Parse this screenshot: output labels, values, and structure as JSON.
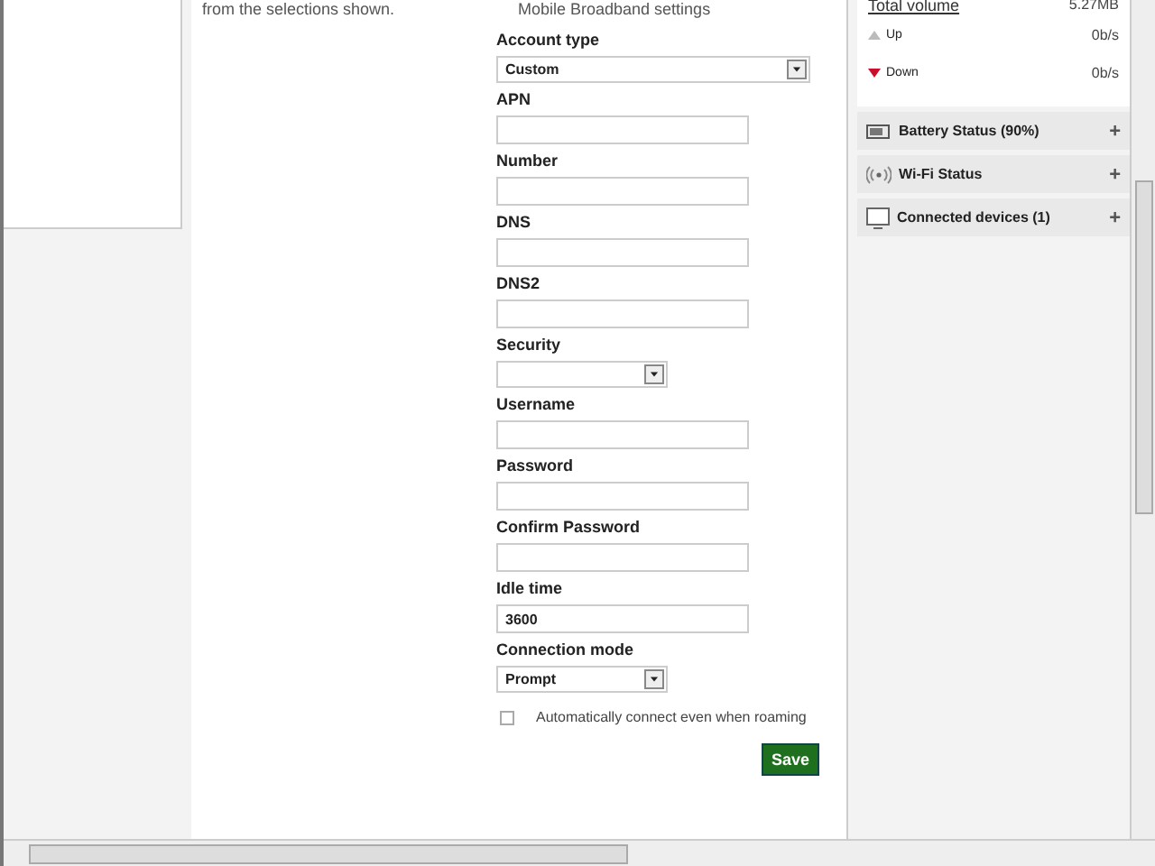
{
  "sidebar": {
    "description": "from the selections shown."
  },
  "form": {
    "option_note": "Mobile Broadband settings",
    "fields": [
      {
        "kind": "combo",
        "label": "Account type",
        "value": "Custom"
      },
      {
        "kind": "text",
        "label": "APN"
      },
      {
        "kind": "text",
        "label": "Number"
      },
      {
        "kind": "text",
        "label": "DNS"
      },
      {
        "kind": "text",
        "label": "DNS2"
      },
      {
        "kind": "select",
        "label": "Security"
      },
      {
        "kind": "text",
        "label": "Username"
      },
      {
        "kind": "text",
        "label": "Password"
      },
      {
        "kind": "text",
        "label": "Confirm Password"
      },
      {
        "kind": "text",
        "label": "Idle time",
        "value": "3600"
      },
      {
        "kind": "select",
        "label": "Connection mode",
        "value": "Prompt"
      }
    ],
    "roaming": {
      "label": "Automatically connect even when roaming",
      "checked": false
    },
    "save_button": "Save"
  },
  "status_panel": {
    "total_volume": {
      "label": "Total volume",
      "value": "5.27MB"
    },
    "rates": [
      {
        "kind": "up",
        "label": "Up",
        "value": "0b/s"
      },
      {
        "kind": "down",
        "label": "Down",
        "value": "0b/s"
      }
    ],
    "sections": [
      {
        "kind": "battery",
        "label": "Battery Status (90%)",
        "toggle": "+"
      },
      {
        "kind": "wifi",
        "label": "Wi-Fi Status",
        "toggle": "+"
      },
      {
        "kind": "devices",
        "label": "Connected devices (1)",
        "toggle": "+"
      }
    ]
  }
}
